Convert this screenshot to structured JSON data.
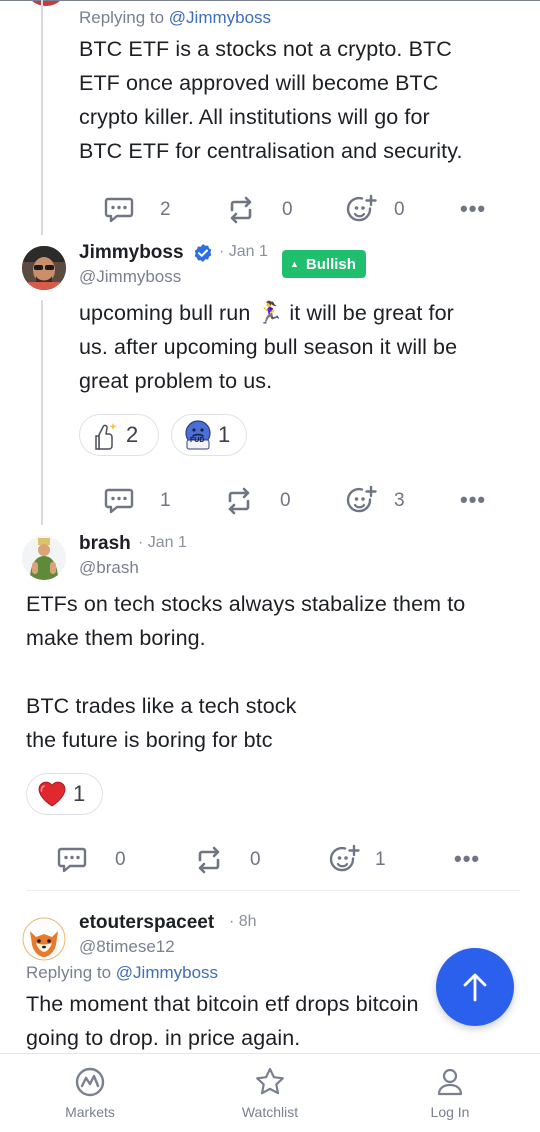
{
  "post1": {
    "reply_prefix": "Replying to ",
    "reply_mention": "@Jimmyboss",
    "text": "BTC ETF is a stocks not a crypto. BTC\nETF once approved will become BTC\ncrypto killer. All institutions will go for\nBTC ETF for centralisation and security.",
    "comments": "2",
    "reposts": "0",
    "reactions": "0"
  },
  "post2": {
    "username": "Jimmyboss",
    "date": "· Jan 1",
    "handle": "@Jimmyboss",
    "sentiment": "Bullish",
    "text": "upcoming bull run 🏃‍♀️ it will be great for\nus. after upcoming bull season it will be\ngreat problem to us.",
    "reaction_thumbs": "2",
    "reaction_fud": "1",
    "fud_label": "FUD",
    "comments": "1",
    "reposts": "0",
    "reactions": "3"
  },
  "post3": {
    "username": "brash",
    "date": "· Jan 1",
    "handle": "@brash",
    "text": "ETFs on tech stocks always stabalize them to\nmake them boring.\n\nBTC trades like a tech stock\nthe future is boring for btc",
    "reaction_heart": "1",
    "comments": "0",
    "reposts": "0",
    "reactions": "1"
  },
  "post4": {
    "username": "etouterspaceet",
    "date": "· 8h",
    "handle": "@8timese12",
    "reply_prefix": "Replying to ",
    "reply_mention": "@Jimmyboss",
    "text": "The moment that bitcoin etf drops bitcoin\ngoing to drop. in price again."
  },
  "more_glyph": "•••",
  "nav": {
    "markets": "Markets",
    "watchlist": "Watchlist",
    "login": "Log In"
  },
  "colors": {
    "accent_blue": "#2a60ec",
    "bullish_green": "#1fbf6e",
    "mention_blue": "#3e6dbb",
    "verified_blue": "#2f6fe4"
  }
}
